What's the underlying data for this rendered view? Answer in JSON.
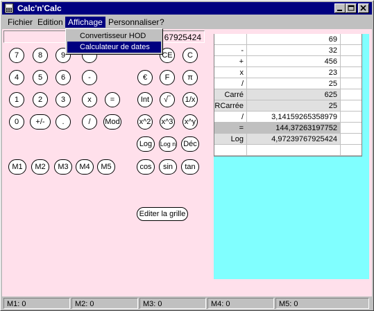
{
  "window": {
    "title": "Calc'n'Calc"
  },
  "menubar": {
    "items": [
      {
        "id": "fichier",
        "label": "Fichier"
      },
      {
        "id": "edition",
        "label": "Edition"
      },
      {
        "id": "affichage",
        "label": "Affichage",
        "active": true
      },
      {
        "id": "personnaliser",
        "label": "Personnaliser"
      },
      {
        "id": "help",
        "label": "?"
      }
    ]
  },
  "dropdown": {
    "items": [
      {
        "label": "Convertisseur HOD"
      },
      {
        "label": "Calculateur de dates",
        "selected": true
      }
    ]
  },
  "display": {
    "value": "67925424"
  },
  "buttons": {
    "seven": "7",
    "eight": "8",
    "nine": "9",
    "clear_entry": "CE",
    "clear": "C",
    "four": "4",
    "five": "5",
    "six": "6",
    "minus": "-",
    "euro": "€",
    "franc": "F",
    "pi": "π",
    "one": "1",
    "two": "2",
    "three": "3",
    "times": "x",
    "equals": "=",
    "int": "Int",
    "sqrt": "√‾",
    "inverse": "1/x",
    "zero": "0",
    "plus_minus": "+/-",
    "dot": ".",
    "divide": "/",
    "mod": "Mod",
    "square": "x^2",
    "cube": "x^3",
    "power": "x^y",
    "log": "Log",
    "log_n": "Log n",
    "dec": "Déc",
    "m1": "M1",
    "m2": "M2",
    "m3": "M3",
    "m4": "M4",
    "m5": "M5",
    "cos": "cos",
    "sin": "sin",
    "tan": "tan",
    "edit_grid": "Editer la grille"
  },
  "grid": {
    "rows": [
      {
        "op": "",
        "value": "69"
      },
      {
        "op": "-",
        "value": "32"
      },
      {
        "op": "+",
        "value": "456"
      },
      {
        "op": "x",
        "value": "23"
      },
      {
        "op": "/",
        "value": "25"
      },
      {
        "op": "Carré",
        "value": "625",
        "style": "shade"
      },
      {
        "op": "RCarrée",
        "value": "25",
        "style": "shade"
      },
      {
        "op": "/",
        "value": "3,14159265358979"
      },
      {
        "op": "=",
        "value": "144,37263197752",
        "style": "dark"
      },
      {
        "op": "Log",
        "value": "4,97239767925424",
        "style": "shade"
      },
      {
        "op": "",
        "value": ""
      }
    ]
  },
  "statusbar": {
    "m1": "M1: 0",
    "m2": "M2: 0",
    "m3": "M3: 0",
    "m4": "M4: 0",
    "m5": "M5: 0"
  },
  "colors": {
    "background": "#ffe0eb",
    "grid_panel": "#80ffff",
    "titlebar": "#000080"
  }
}
